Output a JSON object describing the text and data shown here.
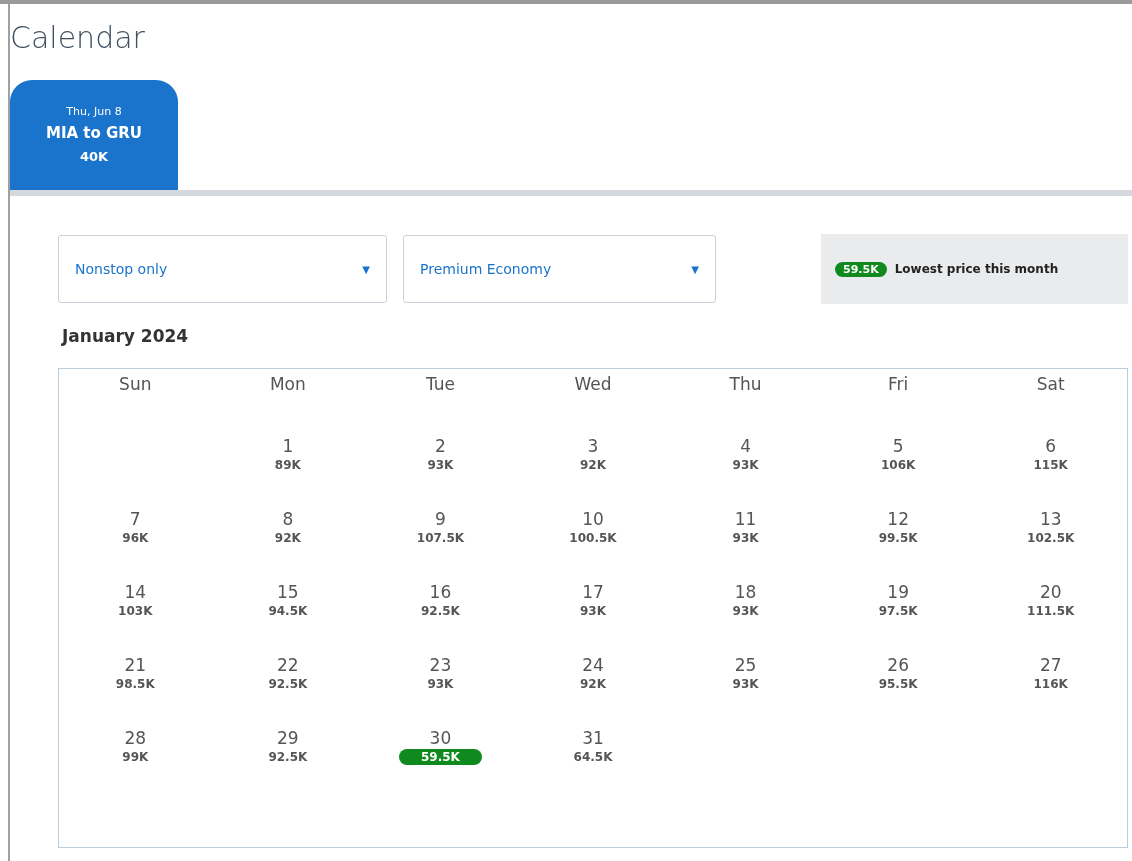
{
  "title": "Calendar",
  "tabs": [
    {
      "date": "Thu, Jun 8",
      "route": "MIA to GRU",
      "price": "40K",
      "selected": true
    }
  ],
  "filters": [
    {
      "value": "Nonstop only",
      "caret": "▼"
    },
    {
      "value": "Premium Economy",
      "caret": "▼"
    }
  ],
  "legend": {
    "badge": "59.5K",
    "label": "Lowest price this month"
  },
  "month": "January 2024",
  "weekdays": [
    "Sun",
    "Mon",
    "Tue",
    "Wed",
    "Thu",
    "Fri",
    "Sat"
  ],
  "weeks": [
    [
      {
        "kind": "empty"
      },
      {
        "kind": "day",
        "day": "1",
        "price": "89K",
        "lowest": false
      },
      {
        "kind": "day",
        "day": "2",
        "price": "93K",
        "lowest": false
      },
      {
        "kind": "day",
        "day": "3",
        "price": "92K",
        "lowest": false
      },
      {
        "kind": "day",
        "day": "4",
        "price": "93K",
        "lowest": false
      },
      {
        "kind": "day",
        "day": "5",
        "price": "106K",
        "lowest": false
      },
      {
        "kind": "day",
        "day": "6",
        "price": "115K",
        "lowest": false
      }
    ],
    [
      {
        "kind": "day",
        "day": "7",
        "price": "96K",
        "lowest": false
      },
      {
        "kind": "day",
        "day": "8",
        "price": "92K",
        "lowest": false
      },
      {
        "kind": "day",
        "day": "9",
        "price": "107.5K",
        "lowest": false
      },
      {
        "kind": "day",
        "day": "10",
        "price": "100.5K",
        "lowest": false
      },
      {
        "kind": "day",
        "day": "11",
        "price": "93K",
        "lowest": false
      },
      {
        "kind": "day",
        "day": "12",
        "price": "99.5K",
        "lowest": false
      },
      {
        "kind": "day",
        "day": "13",
        "price": "102.5K",
        "lowest": false
      }
    ],
    [
      {
        "kind": "day",
        "day": "14",
        "price": "103K",
        "lowest": false
      },
      {
        "kind": "day",
        "day": "15",
        "price": "94.5K",
        "lowest": false
      },
      {
        "kind": "day",
        "day": "16",
        "price": "92.5K",
        "lowest": false
      },
      {
        "kind": "day",
        "day": "17",
        "price": "93K",
        "lowest": false
      },
      {
        "kind": "day",
        "day": "18",
        "price": "93K",
        "lowest": false
      },
      {
        "kind": "day",
        "day": "19",
        "price": "97.5K",
        "lowest": false
      },
      {
        "kind": "day",
        "day": "20",
        "price": "111.5K",
        "lowest": false
      }
    ],
    [
      {
        "kind": "day",
        "day": "21",
        "price": "98.5K",
        "lowest": false
      },
      {
        "kind": "day",
        "day": "22",
        "price": "92.5K",
        "lowest": false
      },
      {
        "kind": "day",
        "day": "23",
        "price": "93K",
        "lowest": false
      },
      {
        "kind": "day",
        "day": "24",
        "price": "92K",
        "lowest": false
      },
      {
        "kind": "day",
        "day": "25",
        "price": "93K",
        "lowest": false
      },
      {
        "kind": "day",
        "day": "26",
        "price": "95.5K",
        "lowest": false
      },
      {
        "kind": "day",
        "day": "27",
        "price": "116K",
        "lowest": false
      }
    ],
    [
      {
        "kind": "day",
        "day": "28",
        "price": "99K",
        "lowest": false
      },
      {
        "kind": "day",
        "day": "29",
        "price": "92.5K",
        "lowest": false
      },
      {
        "kind": "day",
        "day": "30",
        "price": "59.5K",
        "lowest": true
      },
      {
        "kind": "day",
        "day": "31",
        "price": "64.5K",
        "lowest": false
      },
      {
        "kind": "empty"
      },
      {
        "kind": "empty"
      },
      {
        "kind": "empty"
      }
    ]
  ]
}
